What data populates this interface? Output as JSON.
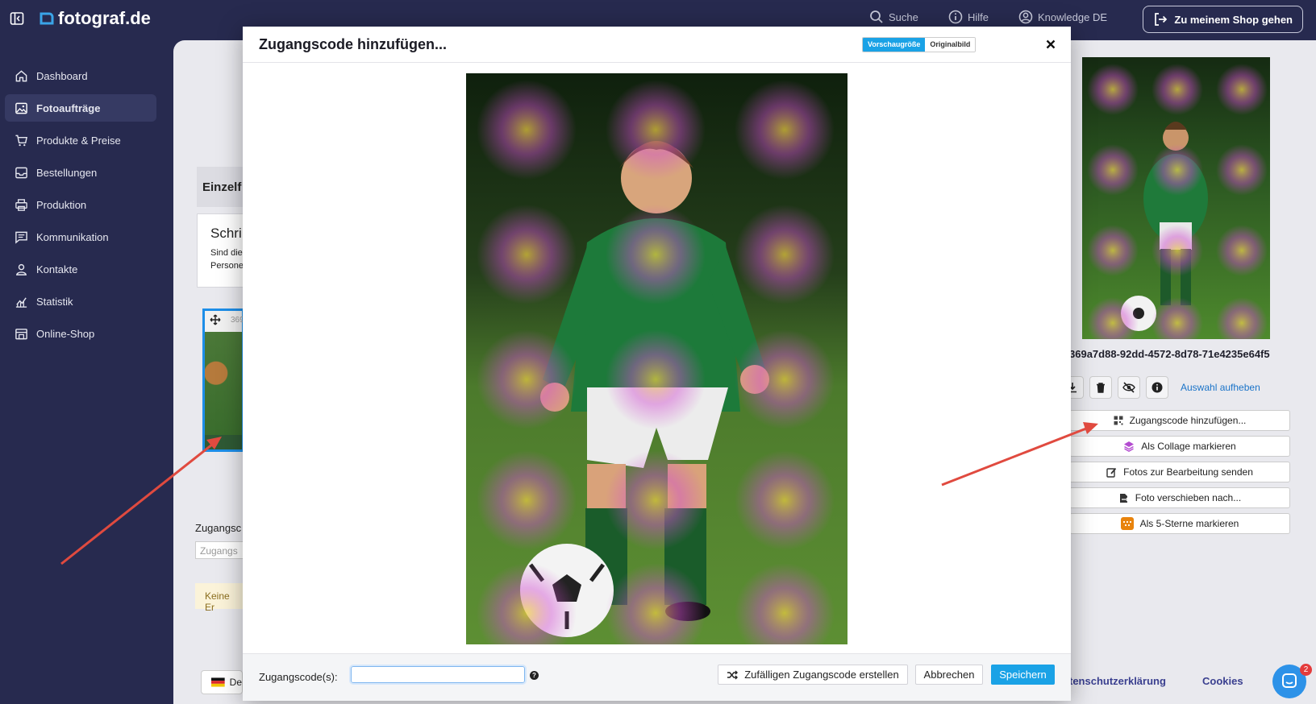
{
  "app": {
    "logo_text": "fotograf.de",
    "nav": [
      {
        "label": "Suche",
        "icon": "search-icon"
      },
      {
        "label": "Hilfe",
        "icon": "info-icon"
      },
      {
        "label": "Knowledge DE",
        "icon": "user-circle-icon"
      }
    ],
    "shop_button": "Zu meinem Shop gehen"
  },
  "sidebar": {
    "items": [
      {
        "label": "Dashboard",
        "icon": "home-icon"
      },
      {
        "label": "Fotoaufträge",
        "icon": "image-icon",
        "active": true
      },
      {
        "label": "Produkte & Preise",
        "icon": "cart-icon"
      },
      {
        "label": "Bestellungen",
        "icon": "inbox-icon"
      },
      {
        "label": "Produktion",
        "icon": "printer-icon"
      },
      {
        "label": "Kommunikation",
        "icon": "message-icon"
      },
      {
        "label": "Kontakte",
        "icon": "person-icon"
      },
      {
        "label": "Statistik",
        "icon": "chart-icon"
      },
      {
        "label": "Online-Shop",
        "icon": "store-icon"
      }
    ]
  },
  "background": {
    "section_title": "Einzelf",
    "card_heading": "Schri",
    "card_text_1": "Sind die",
    "card_text_2": "Persone",
    "thumb_id": "369",
    "zugangscode_label": "Zugangsc",
    "zugangscode_placeholder": "Zugangs",
    "alert_text": "Keine Er",
    "lang_label": "De"
  },
  "detail": {
    "file_id": "369a7d88-92dd-4572-8d78-71e4235e64f5",
    "deselect": "Auswahl aufheben",
    "actions": [
      {
        "label": "Zugangscode hinzufügen...",
        "icon": "qr-grid-icon"
      },
      {
        "label": "Als Collage markieren",
        "icon": "layers-icon"
      },
      {
        "label": "Fotos zur Bearbeitung senden",
        "icon": "edit-icon"
      },
      {
        "label": "Foto verschieben nach...",
        "icon": "file-move-icon"
      },
      {
        "label": "Als 5-Sterne markieren",
        "icon": "stars-icon"
      }
    ]
  },
  "footer": {
    "privacy": "tenschutzerklärung",
    "cookies": "Cookies",
    "chat_badge": "2"
  },
  "modal": {
    "title": "Zugangscode hinzufügen...",
    "size_preview": "Vorschaugröße",
    "size_original": "Originalbild",
    "code_label": "Zugangscode(s):",
    "code_value": "",
    "help": "?",
    "random_button": "Zufälligen Zugangscode erstellen",
    "cancel_button": "Abbrechen",
    "save_button": "Speichern"
  },
  "colors": {
    "sidebar_bg": "#272a4f",
    "accent": "#1aa2e6",
    "arrow": "#e04a3f"
  }
}
